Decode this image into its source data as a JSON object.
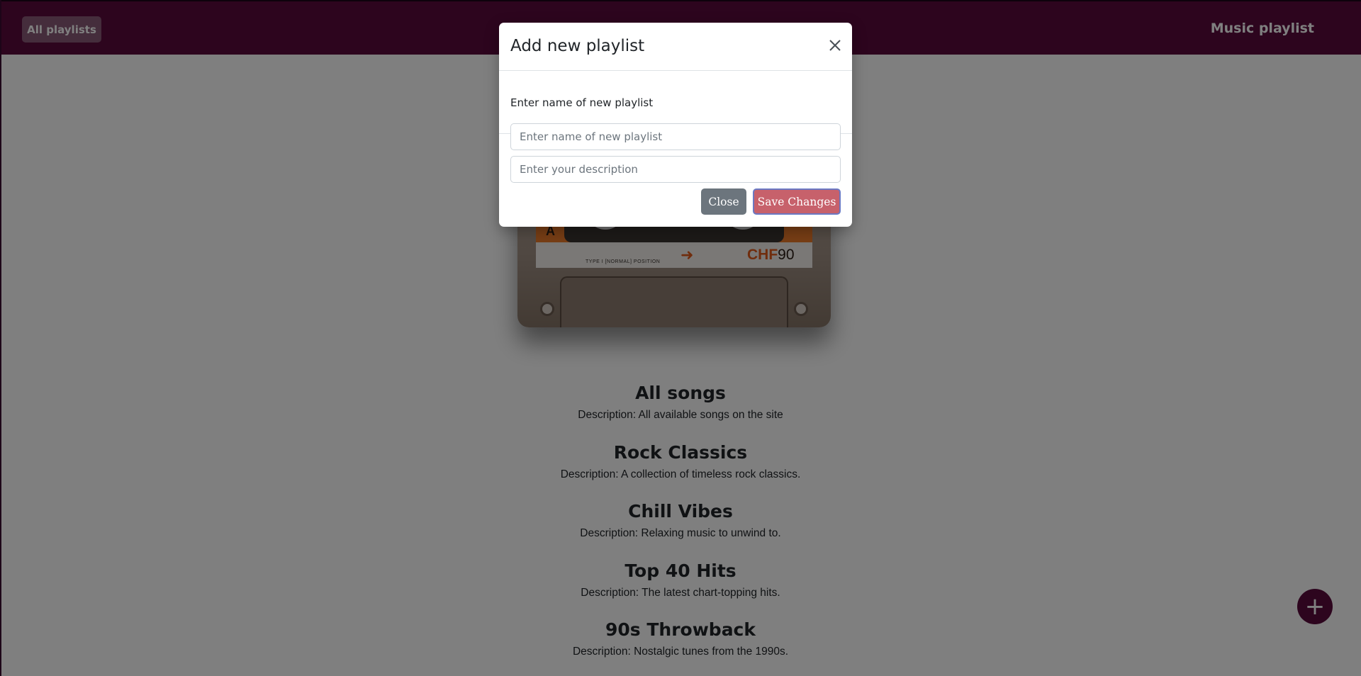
{
  "navbar": {
    "all_playlists_label": "All playlists",
    "app_title": "Music playlist"
  },
  "cassette": {
    "side_label": "A",
    "brand_prefix": "CHF",
    "brand_suffix": "90",
    "type_text": "TYPE I [NORMAL] POSITION"
  },
  "playlists": [
    {
      "title": "All songs",
      "description": "Description: All available songs on the site"
    },
    {
      "title": "Rock Classics",
      "description": "Description: A collection of timeless rock classics."
    },
    {
      "title": "Chill Vibes",
      "description": "Description: Relaxing music to unwind to."
    },
    {
      "title": "Top 40 Hits",
      "description": "Description: The latest chart-topping hits."
    },
    {
      "title": "90s Throwback",
      "description": "Description: Nostalgic tunes from the 1990s."
    }
  ],
  "fab": {
    "icon": "plus-icon",
    "label": "+"
  },
  "modal": {
    "title": "Add new playlist",
    "close_icon": "close-icon",
    "subtitle": "Enter name of new playlist",
    "name_input": {
      "value": "",
      "placeholder": "Enter name of new playlist"
    },
    "description_input": {
      "value": "",
      "placeholder": "Enter your description"
    },
    "close_button_label": "Close",
    "save_button_label": "Save Changes"
  },
  "colors": {
    "brand": "#5a0a3c",
    "save_button": "#c2505c",
    "close_button": "#6c757d"
  }
}
